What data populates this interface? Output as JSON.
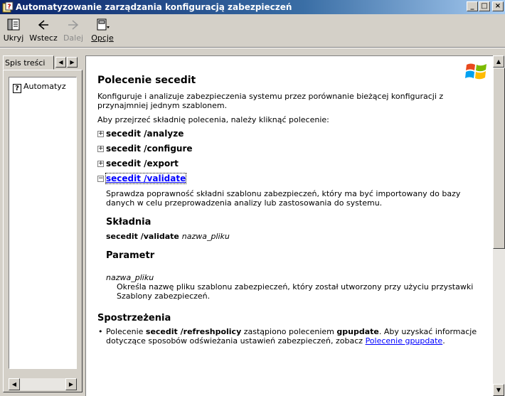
{
  "window": {
    "title": "Automatyzowanie zarządzania konfiguracją zabezpieczeń",
    "minimize": "_",
    "maximize": "□",
    "close": "×"
  },
  "toolbar": {
    "hide_label": "Ukryj",
    "back_label": "Wstecz",
    "forward_label": "Dalej",
    "options_label": "Opcje"
  },
  "nav": {
    "tab_label": "Spis treści",
    "tree_items": [
      "Automatyz"
    ]
  },
  "content": {
    "heading": "Polecenie secedit",
    "intro": "Konfiguruje i analizuje zabezpieczenia systemu przez porównanie bieżącej konfiguracji z przynajmniej jednym szablonem.",
    "prompt": "Aby przejrzeć składnię polecenia, należy kliknąć polecenie:",
    "commands": [
      {
        "label": "secedit /analyze",
        "state": "+"
      },
      {
        "label": "secedit /configure",
        "state": "+"
      },
      {
        "label": "secedit /export",
        "state": "+"
      },
      {
        "label": "secedit /validate",
        "state": "−"
      }
    ],
    "validate_desc": "Sprawdza poprawność składni szablonu zabezpieczeń, który ma być importowany do bazy danych w celu przeprowadzenia analizy lub zastosowania do systemu.",
    "syntax_heading": "Składnia",
    "syntax_cmd": "secedit /validate",
    "syntax_arg": "nazwa_pliku",
    "param_heading": "Parametr",
    "param_name": "nazwa_pliku",
    "param_desc": "Określa nazwę pliku szablonu zabezpieczeń, który został utworzony przy użyciu przystawki Szablony zabezpieczeń.",
    "remarks_heading": "Spostrzeżenia",
    "remark_pre": "Polecenie",
    "remark_cmd": "secedit /refreshpolicy",
    "remark_mid": "zastąpiono poleceniem",
    "remark_cmd2": "gpupdate",
    "remark_post": ". Aby uzyskać informacje dotyczące sposobów odświeżania ustawień zabezpieczeń, zobacz",
    "remark_link": "Polecenie gpupdate",
    "remark_end": "."
  },
  "colors": {
    "titlebar_start": "#0a246a",
    "titlebar_end": "#a6caf0",
    "link": "#0000ff",
    "chrome": "#d4d0c8"
  },
  "icons": [
    "help-app-icon",
    "hide-icon",
    "back-arrow-icon",
    "forward-arrow-icon",
    "options-icon",
    "windows-logo-icon",
    "help-page-icon"
  ]
}
